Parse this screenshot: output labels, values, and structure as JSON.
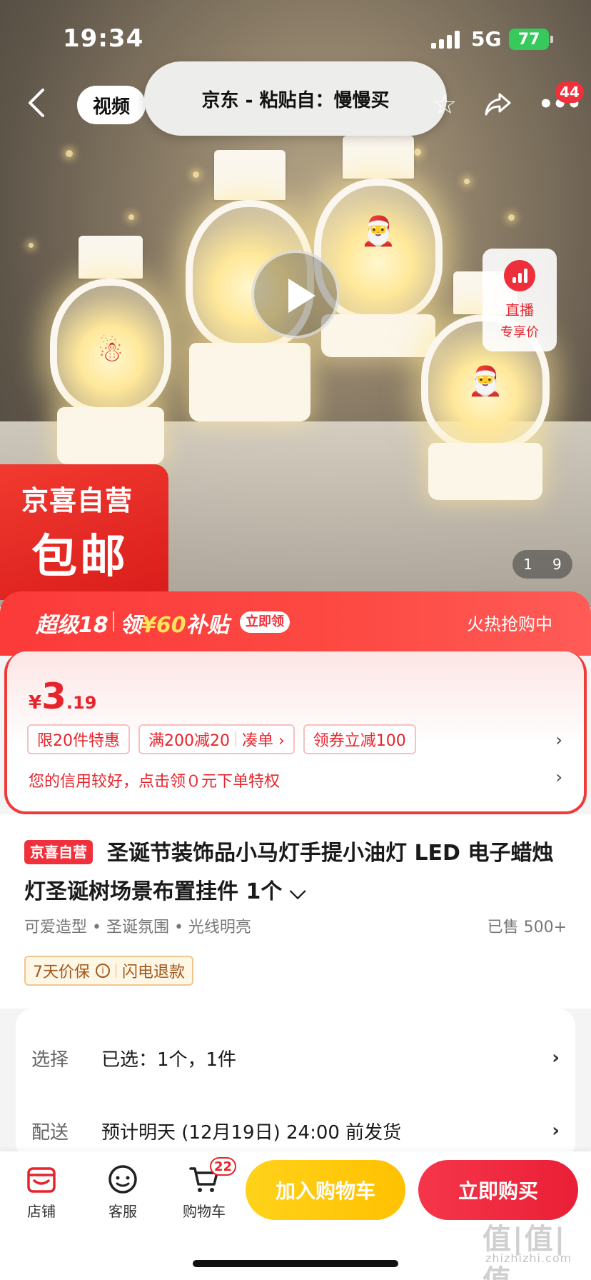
{
  "status_bar": {
    "time": "19:34",
    "network": "5G",
    "battery": "77"
  },
  "nav": {
    "video_tab": "视频",
    "paste_banner": "京东 - 粘贴自：慢慢买",
    "more_badge": "44"
  },
  "gallery": {
    "page_current": "1",
    "page_total": "9",
    "live_line1": "直播",
    "live_line2": "专享价",
    "badge_line1": "京喜自营",
    "badge_line2": "包邮"
  },
  "promo": {
    "label": "超级18",
    "sub_prefix": "领",
    "sub_amount": "¥60",
    "sub_suffix": "补贴",
    "claim": "立即领",
    "hot": "火热抢购中"
  },
  "price": {
    "currency": "¥",
    "integer": "3",
    "decimal": ".19"
  },
  "tags": {
    "limit": "限20件特惠",
    "full_discount": "满200减20",
    "gather": "凑单 ›",
    "coupon": "领券立减100"
  },
  "credit_text": "您的信用较好，点击领０元下单特权",
  "product": {
    "store_tag": "京喜自营",
    "title": "圣诞节装饰品小马灯手提小油灯 LED 电子蜡烛灯圣诞树场景布置挂件 1个",
    "features": "可爱造型  • 圣诞氛围  • 光线明亮",
    "sold": "已售 500+",
    "guarantee_1": "7天价保",
    "guarantee_2": "闪电退款"
  },
  "options": [
    {
      "key": "选择",
      "value": "已选：1个，1件"
    },
    {
      "key": "配送",
      "value": "预计明天 (12月19日) 24:00 前发货"
    }
  ],
  "bottom": {
    "store": "店铺",
    "service": "客服",
    "cart": "购物车",
    "cart_badge": "22",
    "add_cart": "加入购物车",
    "buy_now": "立即购买"
  },
  "watermark": {
    "main": "值|值|值",
    "sub": "zhizhizhi.com"
  }
}
